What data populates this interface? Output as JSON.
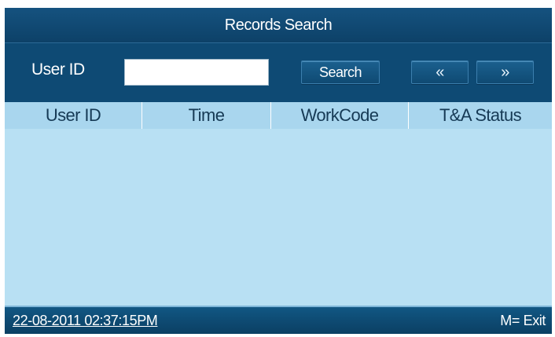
{
  "title": "Records Search",
  "search": {
    "user_id_label": "User ID",
    "user_id_value": "",
    "search_button": "Search",
    "prev_button": "«",
    "next_button": "»"
  },
  "table": {
    "columns": [
      "User ID",
      "Time",
      "WorkCode",
      "T&A Status"
    ],
    "rows": []
  },
  "status_bar": {
    "datetime": "22-08-2011 02:37:15PM",
    "exit_hint": "M= Exit"
  },
  "colors": {
    "title_bar": "#0d4168",
    "search_bar": "#0e4a74",
    "header_row": "#a9d6ee",
    "body": "#b8e0f3"
  }
}
